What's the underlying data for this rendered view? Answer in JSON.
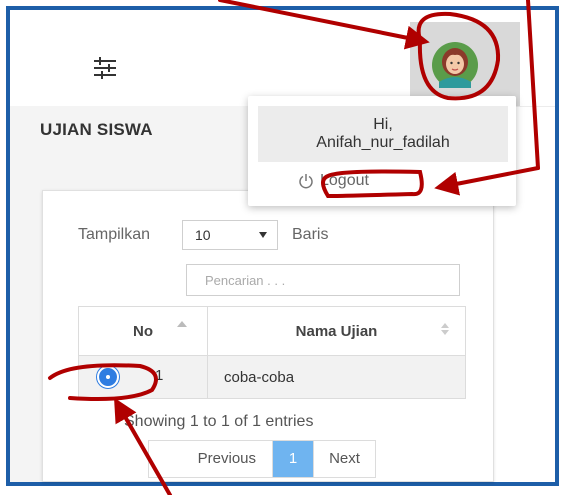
{
  "topbar": {
    "menu_icon": "sliders-icon",
    "avatar_icon": "user-avatar-icon"
  },
  "user_menu": {
    "greeting_line1": "Hi,",
    "username": "Anifah_nur_fadilah",
    "logout_label": "Logout",
    "logout_icon": "power-icon"
  },
  "page": {
    "title": "UJIAN SISWA"
  },
  "table_controls": {
    "show_prefix": "Tampilkan",
    "rows_value": "10",
    "show_suffix": "Baris",
    "search_placeholder": "Pencarian . . ."
  },
  "table": {
    "columns": [
      "No",
      "Nama Ujian"
    ],
    "rows": [
      {
        "no": "1",
        "nama_ujian": "coba-coba"
      }
    ]
  },
  "footer": {
    "info": "Showing 1 to 1 of 1 entries",
    "previous_label": "Previous",
    "current_page": "1",
    "next_label": "Next"
  },
  "colors": {
    "frame_border": "#1d5ea8",
    "annotation_red": "#b00000",
    "expand_button": "#2f7de1",
    "active_page": "#6fb4f0"
  }
}
